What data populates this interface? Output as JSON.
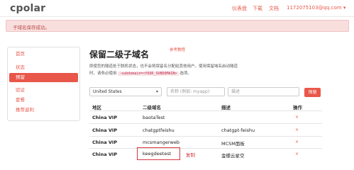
{
  "header": {
    "logo": "cpolar",
    "nav": [
      "仪表盘",
      "下载",
      "文档"
    ],
    "user": "1172075103@qq.com ▾"
  },
  "alert": {
    "text": "子域名保存成功。"
  },
  "sidebar": {
    "items": [
      {
        "label": "首页",
        "active": false
      },
      {
        "label": "状态",
        "active": false
      },
      {
        "label": "预留",
        "active": true
      },
      {
        "label": "验证",
        "active": false
      },
      {
        "label": "套餐",
        "active": false
      },
      {
        "label": "推荐返利",
        "active": false
      }
    ]
  },
  "main": {
    "title": "保留二级子域名",
    "ref_link": "参考教程",
    "desc_line1": "即使您的隧道处于脱机状态，也不会将保留名分配给其他用户。使用保留域名启动隧道",
    "desc_line2_pre": "时，请务必使用",
    "desc_code": "-subdomain=<YOUR_SUBDOMAIN>",
    "desc_line2_post": "选项。"
  },
  "form": {
    "region_value": "United States",
    "name_placeholder": "名称 (例如: myapp)",
    "desc_placeholder": "描述",
    "reserve_label": "保留"
  },
  "table": {
    "headers": [
      "地区",
      "二级域名",
      "描述",
      "操作"
    ],
    "rows": [
      {
        "region": "China VIP",
        "subdomain": "baotaTest",
        "description": "",
        "action": "×"
      },
      {
        "region": "China VIP",
        "subdomain": "chatgptfeishu",
        "description": "chatgpt-feishu",
        "action": "×"
      },
      {
        "region": "China VIP",
        "subdomain": "mcsmangerweb",
        "description": "MCSM面板",
        "action": "×"
      },
      {
        "region": "China VIP",
        "subdomain": "keegdeetest",
        "description": "金蝶云星空",
        "action": "×"
      }
    ]
  },
  "annotation": {
    "copy_label": "复制"
  },
  "colors": {
    "accent": "#e8574a",
    "alert_bg": "#f9dede",
    "highlight": "#d9363e"
  }
}
